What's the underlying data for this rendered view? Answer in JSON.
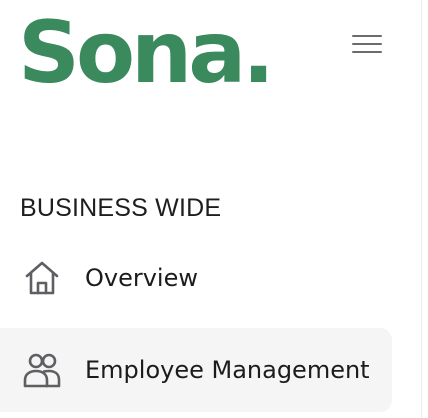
{
  "brand": {
    "name": "Sona.",
    "color": "#3a8a5e"
  },
  "header": {
    "menu_icon": "hamburger-menu-icon"
  },
  "sidebar": {
    "section_label": "BUSINESS WIDE",
    "items": [
      {
        "label": "Overview",
        "icon": "home-icon",
        "active": false
      },
      {
        "label": "Employee Management",
        "icon": "users-icon",
        "active": true
      }
    ]
  },
  "colors": {
    "icon": "#5f5f63",
    "active_background": "#f5f5f5",
    "text": "#1c1c1c"
  }
}
